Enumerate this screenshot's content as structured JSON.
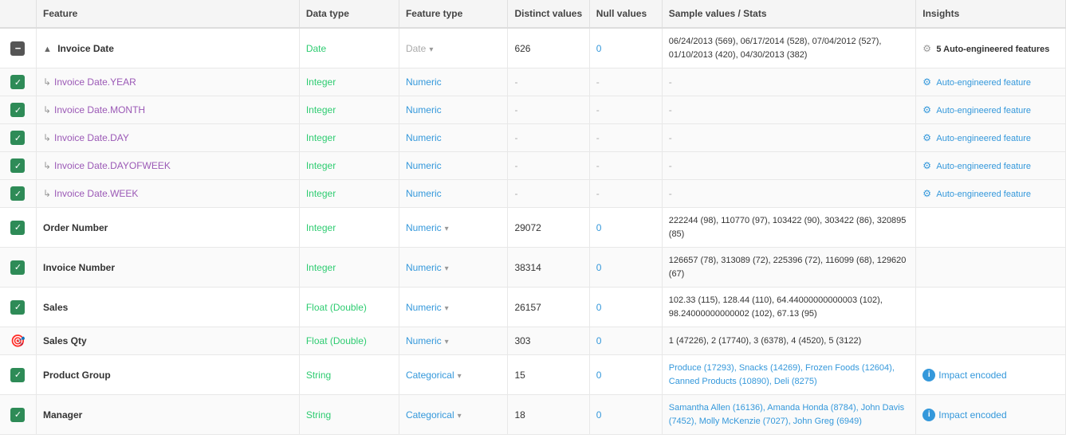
{
  "header": {
    "cols": [
      {
        "label": "",
        "class": "col-checkbox"
      },
      {
        "label": "Feature",
        "class": "col-feature"
      },
      {
        "label": "Data type",
        "class": "col-datatype"
      },
      {
        "label": "Feature type",
        "class": "col-featuretype"
      },
      {
        "label": "Distinct values",
        "class": "col-distinct"
      },
      {
        "label": "Null values",
        "class": "col-null"
      },
      {
        "label": "Sample values / Stats",
        "class": "col-sample"
      },
      {
        "label": "Insights",
        "class": "col-insights"
      }
    ]
  },
  "rows": [
    {
      "id": "invoice-date",
      "checkbox": "minus",
      "feature": "Invoice Date",
      "feature_style": "bold",
      "feature_prefix": "▲ ",
      "datatype": "Date",
      "datatype_class": "type-date",
      "featuretype": "Date",
      "featuretype_class": "ftype-date",
      "featuretype_dropdown": true,
      "distinct": "626",
      "null": "0",
      "null_class": "null-zero",
      "sample": "06/24/2013 (569), 06/17/2014 (528), 07/04/2012 (527), 01/10/2013 (420), 04/30/2013 (382)",
      "sample_class": "sample-dark",
      "insights": "5 Auto-engineered features",
      "insights_type": "auto-count"
    },
    {
      "id": "invoice-date-year",
      "checkbox": "green",
      "feature": "Invoice Date.YEAR",
      "feature_style": "sub",
      "feature_prefix": "↳ ",
      "datatype": "Integer",
      "datatype_class": "type-integer",
      "featuretype": "Numeric",
      "featuretype_class": "ftype-numeric",
      "featuretype_dropdown": false,
      "distinct": "-",
      "null": "-",
      "null_class": "dash",
      "sample": "-",
      "sample_class": "dash",
      "insights": "Auto-engineered feature",
      "insights_type": "auto-link"
    },
    {
      "id": "invoice-date-month",
      "checkbox": "green",
      "feature": "Invoice Date.MONTH",
      "feature_style": "sub",
      "feature_prefix": "↳ ",
      "datatype": "Integer",
      "datatype_class": "type-integer",
      "featuretype": "Numeric",
      "featuretype_class": "ftype-numeric",
      "featuretype_dropdown": false,
      "distinct": "-",
      "null": "-",
      "null_class": "dash",
      "sample": "-",
      "sample_class": "dash",
      "insights": "Auto-engineered feature",
      "insights_type": "auto-link"
    },
    {
      "id": "invoice-date-day",
      "checkbox": "green",
      "feature": "Invoice Date.DAY",
      "feature_style": "sub",
      "feature_prefix": "↳ ",
      "datatype": "Integer",
      "datatype_class": "type-integer",
      "featuretype": "Numeric",
      "featuretype_class": "ftype-numeric",
      "featuretype_dropdown": false,
      "distinct": "-",
      "null": "-",
      "null_class": "dash",
      "sample": "-",
      "sample_class": "dash",
      "insights": "Auto-engineered feature",
      "insights_type": "auto-link"
    },
    {
      "id": "invoice-date-dayofweek",
      "checkbox": "green",
      "feature": "Invoice Date.DAYOFWEEK",
      "feature_style": "sub",
      "feature_prefix": "↳ ",
      "datatype": "Integer",
      "datatype_class": "type-integer",
      "featuretype": "Numeric",
      "featuretype_class": "ftype-numeric",
      "featuretype_dropdown": false,
      "distinct": "-",
      "null": "-",
      "null_class": "dash",
      "sample": "-",
      "sample_class": "dash",
      "insights": "Auto-engineered feature",
      "insights_type": "auto-link"
    },
    {
      "id": "invoice-date-week",
      "checkbox": "green",
      "feature": "Invoice Date.WEEK",
      "feature_style": "sub",
      "feature_prefix": "↳ ",
      "datatype": "Integer",
      "datatype_class": "type-integer",
      "featuretype": "Numeric",
      "featuretype_class": "ftype-numeric",
      "featuretype_dropdown": false,
      "distinct": "-",
      "null": "-",
      "null_class": "dash",
      "sample": "-",
      "sample_class": "dash",
      "insights": "Auto-engineered feature",
      "insights_type": "auto-link"
    },
    {
      "id": "order-number",
      "checkbox": "green",
      "feature": "Order Number",
      "feature_style": "bold",
      "feature_prefix": "",
      "datatype": "Integer",
      "datatype_class": "type-integer",
      "featuretype": "Numeric",
      "featuretype_class": "ftype-numeric",
      "featuretype_dropdown": true,
      "distinct": "29072",
      "null": "0",
      "null_class": "null-zero",
      "sample": "222244 (98), 110770 (97), 103422 (90), 303422 (86), 320895 (85)",
      "sample_class": "sample-dark",
      "insights": "",
      "insights_type": "none"
    },
    {
      "id": "invoice-number",
      "checkbox": "green",
      "feature": "Invoice Number",
      "feature_style": "bold",
      "feature_prefix": "",
      "datatype": "Integer",
      "datatype_class": "type-integer",
      "featuretype": "Numeric",
      "featuretype_class": "ftype-numeric",
      "featuretype_dropdown": true,
      "distinct": "38314",
      "null": "0",
      "null_class": "null-zero",
      "sample": "126657 (78), 313089 (72), 225396 (72), 116099 (68), 129620 (67)",
      "sample_class": "sample-dark",
      "insights": "",
      "insights_type": "none"
    },
    {
      "id": "sales",
      "checkbox": "green",
      "feature": "Sales",
      "feature_style": "bold",
      "feature_prefix": "",
      "datatype": "Float (Double)",
      "datatype_class": "type-float",
      "featuretype": "Numeric",
      "featuretype_class": "ftype-numeric",
      "featuretype_dropdown": true,
      "distinct": "26157",
      "null": "0",
      "null_class": "null-zero",
      "sample": "102.33 (115), 128.44 (110), 64.44000000000003 (102), 98.24000000000002 (102), 67.13 (95)",
      "sample_class": "sample-dark",
      "insights": "",
      "insights_type": "none"
    },
    {
      "id": "sales-qty",
      "checkbox": "target",
      "feature": "Sales Qty",
      "feature_style": "bold",
      "feature_prefix": "",
      "datatype": "Float (Double)",
      "datatype_class": "type-float",
      "featuretype": "Numeric",
      "featuretype_class": "ftype-numeric",
      "featuretype_dropdown": true,
      "distinct": "303",
      "null": "0",
      "null_class": "null-zero",
      "sample": "1 (47226), 2 (17740), 3 (6378), 4 (4520), 5 (3122)",
      "sample_class": "sample-dark",
      "insights": "",
      "insights_type": "none"
    },
    {
      "id": "product-group",
      "checkbox": "green",
      "feature": "Product Group",
      "feature_style": "bold",
      "feature_prefix": "",
      "datatype": "String",
      "datatype_class": "type-string",
      "featuretype": "Categorical",
      "featuretype_class": "ftype-categorical",
      "featuretype_dropdown": true,
      "distinct": "15",
      "null": "0",
      "null_class": "null-zero",
      "sample": "Produce (17293), Snacks (14269), Frozen Foods (12604), Canned Products (10890), Deli (8275)",
      "sample_class": "sample-text",
      "insights": "Impact encoded",
      "insights_type": "impact"
    },
    {
      "id": "manager",
      "checkbox": "green",
      "feature": "Manager",
      "feature_style": "bold",
      "feature_prefix": "",
      "datatype": "String",
      "datatype_class": "type-string",
      "featuretype": "Categorical",
      "featuretype_class": "ftype-categorical",
      "featuretype_dropdown": true,
      "distinct": "18",
      "null": "0",
      "null_class": "null-zero",
      "sample": "Samantha Allen (16136), Amanda Honda (8784), John Davis (7452), Molly McKenzie (7027), John Greg (6949)",
      "sample_class": "sample-text",
      "insights": "Impact encoded",
      "insights_type": "impact"
    }
  ]
}
